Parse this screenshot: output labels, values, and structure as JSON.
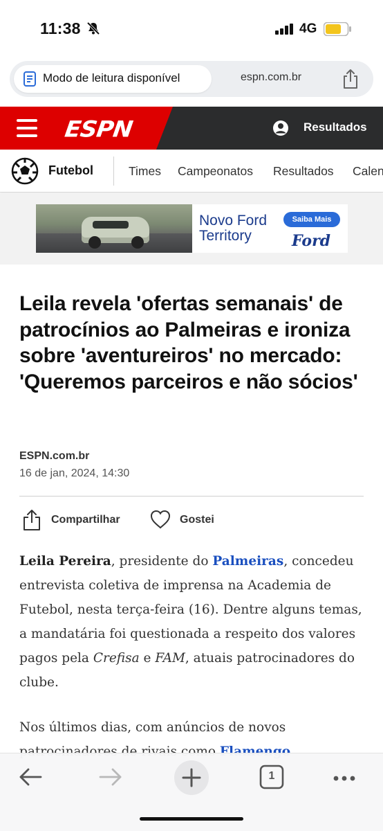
{
  "status_bar": {
    "time": "11:38",
    "network": "4G",
    "battery_color": "#f3c51d"
  },
  "browser": {
    "reader_mode_label": "Modo de leitura disponível",
    "domain": "espn.com.br"
  },
  "espn_header": {
    "logo": "ESPN",
    "results_label": "Resultados",
    "accent_color": "#dd0000"
  },
  "subnav": {
    "sport": "Futebol",
    "items": [
      "Times",
      "Campeonatos",
      "Resultados",
      "Calendário"
    ]
  },
  "ad": {
    "line1": "Novo Ford",
    "line2": "Territory",
    "cta": "Saiba Mais",
    "brand": "Ford"
  },
  "article": {
    "headline": "Leila revela 'ofertas semanais' de patrocínios ao Palmeiras e ironiza sobre 'aventureiros' no mercado: 'Queremos parceiros e não sócios'",
    "source": "ESPN.com.br",
    "date": "16 de jan, 2024, 14:30",
    "share_label": "Compartilhar",
    "like_label": "Gostei",
    "p1": {
      "name": "Leila Pereira",
      "t1": ", presidente do ",
      "club": "Palmeiras",
      "t2": ", concedeu entrevista coletiva de imprensa na Academia de Futebol, nesta terça-feira (16). Dentre alguns temas, a mandatária foi questionada a respeito dos valores pagos pela ",
      "sponsor1": "Crefisa",
      "t3": " e ",
      "sponsor2": "FAM",
      "t4": ", atuais patrocinadores do clube."
    },
    "p2": {
      "t1": "Nos últimos dias, com anúncios de novos patrocinadores de rivais como ",
      "link": "Flamengo"
    }
  },
  "toolbar": {
    "tab_count": "1"
  }
}
